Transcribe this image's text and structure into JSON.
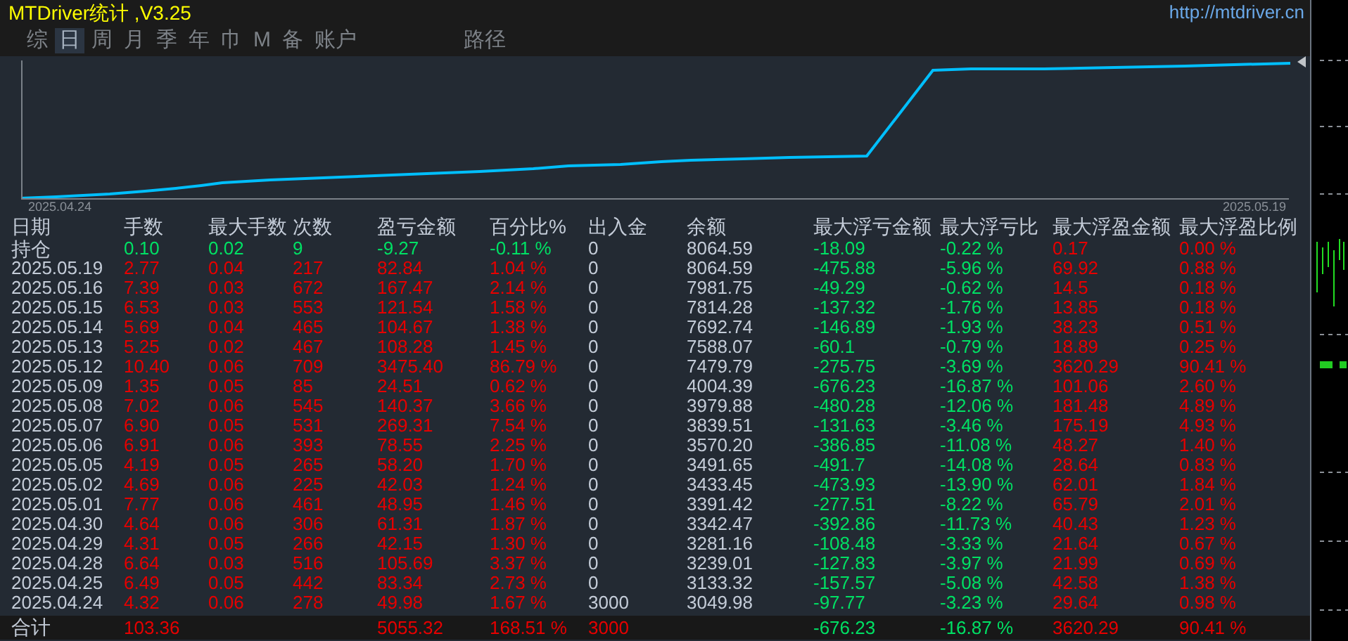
{
  "title": "MTDriver统计 ,V3.25",
  "url": "http://mtdriver.cn",
  "tabs": [
    {
      "label": "综",
      "selected": false
    },
    {
      "label": "日",
      "selected": true
    },
    {
      "label": "周",
      "selected": false
    },
    {
      "label": "月",
      "selected": false
    },
    {
      "label": "季",
      "selected": false
    },
    {
      "label": "年",
      "selected": false
    },
    {
      "label": "巾",
      "selected": false
    },
    {
      "label": "M",
      "selected": false
    },
    {
      "label": "备",
      "selected": false
    },
    {
      "label": "账户",
      "selected": false
    },
    {
      "label": "路径",
      "selected": false
    }
  ],
  "chart": {
    "start_label": "2025.04.24",
    "end_label": "2025.05.19"
  },
  "table": {
    "columns": [
      "日期",
      "手数",
      "最大手数",
      "次数",
      "盈亏金额",
      "百分比%",
      "出入金",
      "余额",
      "最大浮亏金额",
      "最大浮亏比",
      "最大浮盈金额",
      "最大浮盈比例"
    ],
    "rows": [
      {
        "kind": "position",
        "cells": [
          "持仓",
          "0.10",
          "0.02",
          "9",
          "-9.27",
          "-0.11 %",
          "0",
          "8064.59",
          "-18.09",
          "-0.22 %",
          "0.17",
          "0.00 %"
        ]
      },
      {
        "kind": "day",
        "cells": [
          "2025.05.19",
          "2.77",
          "0.04",
          "217",
          "82.84",
          "1.04 %",
          "0",
          "8064.59",
          "-475.88",
          "-5.96 %",
          "69.92",
          "0.88 %"
        ]
      },
      {
        "kind": "day",
        "cells": [
          "2025.05.16",
          "7.39",
          "0.03",
          "672",
          "167.47",
          "2.14 %",
          "0",
          "7981.75",
          "-49.29",
          "-0.62 %",
          "14.5",
          "0.18 %"
        ]
      },
      {
        "kind": "day",
        "cells": [
          "2025.05.15",
          "6.53",
          "0.03",
          "553",
          "121.54",
          "1.58 %",
          "0",
          "7814.28",
          "-137.32",
          "-1.76 %",
          "13.85",
          "0.18 %"
        ]
      },
      {
        "kind": "day",
        "cells": [
          "2025.05.14",
          "5.69",
          "0.04",
          "465",
          "104.67",
          "1.38 %",
          "0",
          "7692.74",
          "-146.89",
          "-1.93 %",
          "38.23",
          "0.51 %"
        ]
      },
      {
        "kind": "day",
        "cells": [
          "2025.05.13",
          "5.25",
          "0.02",
          "467",
          "108.28",
          "1.45 %",
          "0",
          "7588.07",
          "-60.1",
          "-0.79 %",
          "18.89",
          "0.25 %"
        ]
      },
      {
        "kind": "day",
        "cells": [
          "2025.05.12",
          "10.40",
          "0.06",
          "709",
          "3475.40",
          "86.79 %",
          "0",
          "7479.79",
          "-275.75",
          "-3.69 %",
          "3620.29",
          "90.41 %"
        ]
      },
      {
        "kind": "day",
        "cells": [
          "2025.05.09",
          "1.35",
          "0.05",
          "85",
          "24.51",
          "0.62 %",
          "0",
          "4004.39",
          "-676.23",
          "-16.87 %",
          "101.06",
          "2.60 %"
        ]
      },
      {
        "kind": "day",
        "cells": [
          "2025.05.08",
          "7.02",
          "0.06",
          "545",
          "140.37",
          "3.66 %",
          "0",
          "3979.88",
          "-480.28",
          "-12.06 %",
          "181.48",
          "4.89 %"
        ]
      },
      {
        "kind": "day",
        "cells": [
          "2025.05.07",
          "6.90",
          "0.05",
          "531",
          "269.31",
          "7.54 %",
          "0",
          "3839.51",
          "-131.63",
          "-3.46 %",
          "175.19",
          "4.93 %"
        ]
      },
      {
        "kind": "day",
        "cells": [
          "2025.05.06",
          "6.91",
          "0.06",
          "393",
          "78.55",
          "2.25 %",
          "0",
          "3570.20",
          "-386.85",
          "-11.08 %",
          "48.27",
          "1.40 %"
        ]
      },
      {
        "kind": "day",
        "cells": [
          "2025.05.05",
          "4.19",
          "0.05",
          "265",
          "58.20",
          "1.70 %",
          "0",
          "3491.65",
          "-491.7",
          "-14.08 %",
          "28.64",
          "0.83 %"
        ]
      },
      {
        "kind": "day",
        "cells": [
          "2025.05.02",
          "4.69",
          "0.06",
          "225",
          "42.03",
          "1.24 %",
          "0",
          "3433.45",
          "-473.93",
          "-13.90 %",
          "62.01",
          "1.84 %"
        ]
      },
      {
        "kind": "day",
        "cells": [
          "2025.05.01",
          "7.77",
          "0.06",
          "461",
          "48.95",
          "1.46 %",
          "0",
          "3391.42",
          "-277.51",
          "-8.22 %",
          "65.79",
          "2.01 %"
        ]
      },
      {
        "kind": "day",
        "cells": [
          "2025.04.30",
          "4.64",
          "0.06",
          "306",
          "61.31",
          "1.87 %",
          "0",
          "3342.47",
          "-392.86",
          "-11.73 %",
          "40.43",
          "1.23 %"
        ]
      },
      {
        "kind": "day",
        "cells": [
          "2025.04.29",
          "4.31",
          "0.05",
          "266",
          "42.15",
          "1.30 %",
          "0",
          "3281.16",
          "-108.48",
          "-3.33 %",
          "21.64",
          "0.67 %"
        ]
      },
      {
        "kind": "day",
        "cells": [
          "2025.04.28",
          "6.64",
          "0.03",
          "516",
          "105.69",
          "3.37 %",
          "0",
          "3239.01",
          "-127.83",
          "-3.97 %",
          "21.99",
          "0.69 %"
        ]
      },
      {
        "kind": "day",
        "cells": [
          "2025.04.25",
          "6.49",
          "0.05",
          "442",
          "83.34",
          "2.73 %",
          "0",
          "3133.32",
          "-157.57",
          "-5.08 %",
          "42.58",
          "1.38 %"
        ]
      },
      {
        "kind": "day",
        "cells": [
          "2025.04.24",
          "4.32",
          "0.06",
          "278",
          "49.98",
          "1.67 %",
          "3000",
          "3049.98",
          "-97.77",
          "-3.23 %",
          "29.64",
          "0.98 %"
        ]
      },
      {
        "kind": "total",
        "cells": [
          "合计",
          "103.36",
          "",
          "",
          "5055.32",
          "168.51 %",
          "3000",
          "",
          "-676.23",
          "-16.87 %",
          "3620.29",
          "90.41 %"
        ]
      }
    ]
  }
}
